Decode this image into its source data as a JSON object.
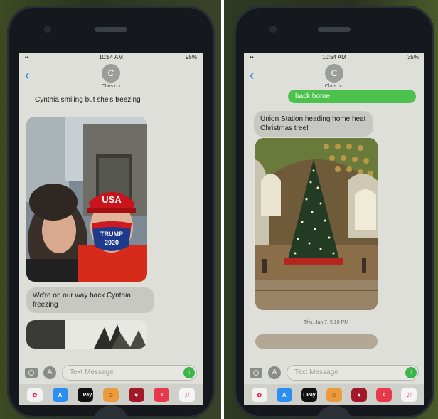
{
  "left_phone": {
    "status": {
      "signal": "••",
      "time": "10:54 AM",
      "battery": "95%"
    },
    "header": {
      "back": "‹",
      "avatar_letter": "C",
      "contact": "Chris o ›"
    },
    "messages": {
      "top_text": "Cynthia smiling but she's freezing",
      "caption": "We're on our way back Cynthia freezing"
    },
    "selfie": {
      "hat_text": "USA",
      "mask_line1": "TRUMP",
      "mask_line2": "2020"
    },
    "input": {
      "placeholder": "Text Message",
      "send": "↑"
    },
    "apps": [
      "✿",
      "A",
      "Pay",
      "☺",
      "♥",
      "⌕",
      "♫"
    ]
  },
  "right_phone": {
    "status": {
      "signal": "••",
      "time": "10:54 AM",
      "battery": "35%"
    },
    "header": {
      "back": "‹",
      "avatar_letter": "C",
      "contact": "Chris o ›"
    },
    "messages": {
      "out_text": "back home",
      "in_text": "Union Station heading home heat Christmas tree!",
      "timestamp": "Thu, Jan 7, 5:10 PM"
    },
    "input": {
      "placeholder": "Text Message",
      "send": "↑"
    },
    "apps": [
      "✿",
      "A",
      "Pay",
      "☺",
      "♥",
      "⌕",
      "♫"
    ]
  }
}
